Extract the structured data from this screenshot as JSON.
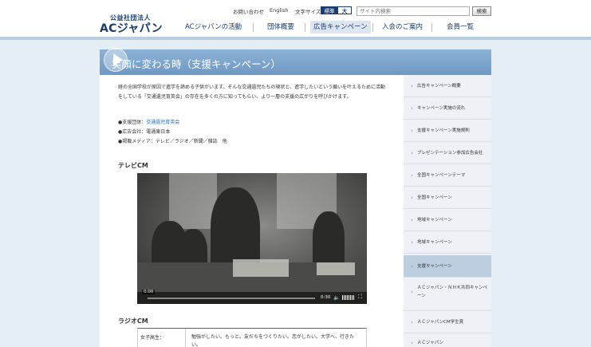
{
  "header": {
    "logo_small": "公益社団法人",
    "logo_big": "ACジャパン",
    "utility": {
      "contact": "お問い合わせ",
      "english": "English",
      "text_size_label": "文字サイズ",
      "size_standard": "標準",
      "size_large": "大"
    },
    "search": {
      "placeholder": "サイト内検索",
      "button": "検索"
    },
    "nav": [
      {
        "label": "ACジャパンの活動"
      },
      {
        "label": "団体概要"
      },
      {
        "label": "広告キャンペーン",
        "active": true
      },
      {
        "label": "入会のご案内"
      },
      {
        "label": "会員一覧"
      }
    ]
  },
  "page": {
    "title": "笑顔に変わる時（支援キャンペーン）",
    "intro": "経の全国学校が原因で進学を諦める子供がいます。そんな交通遺児たちの現状と、進学したいという願いを叶えるために活動をしている「交通遺児育英会」の存在を多くの方に知ってもらい、より一層の支援の広がりを呼びかけます。",
    "meta": {
      "org_label": "●支援団体：",
      "org_value": "交通遺児育英会",
      "agency": "●広告会社：電通東日本",
      "media": "●掲載メディア：テレビ／ラジオ／新聞／雑誌　他"
    },
    "tv_heading": "テレビCM",
    "video": {
      "current_time": "0:00",
      "duration": "0:30"
    },
    "radio_heading": "ラジオCM",
    "radio_table": {
      "header": "女子高生：",
      "line": "勉強がしたい。もっと。友だちをつくりたい。恋がしたい。大学へ、行きたい。"
    }
  },
  "sidebar": {
    "items": [
      {
        "label": "広告キャンペーン概要"
      },
      {
        "label": "キャンペーン実施の流れ"
      },
      {
        "label": "支援キャンペーン実施規則"
      },
      {
        "label": "プレゼンテーション参加広告会社"
      },
      {
        "label": "全国キャンペーンテーマ"
      },
      {
        "label": "全国キャンペーン"
      },
      {
        "label": "地域キャンペーン"
      },
      {
        "label": "地域キャンペーン"
      },
      {
        "label": "支援キャンペーン",
        "active": true
      },
      {
        "label": "ＡＣジャパン・ＮＨＫ共同キャンペーン"
      },
      {
        "label": "ＡＣジャパンCM学生賞"
      },
      {
        "label": "ＡＣジャパン"
      }
    ]
  },
  "colors": {
    "brand": "#1a3c6e",
    "title_bar": "#7ba3cc",
    "link": "#2a6cb0",
    "sidebar_active": "#bccee0"
  }
}
